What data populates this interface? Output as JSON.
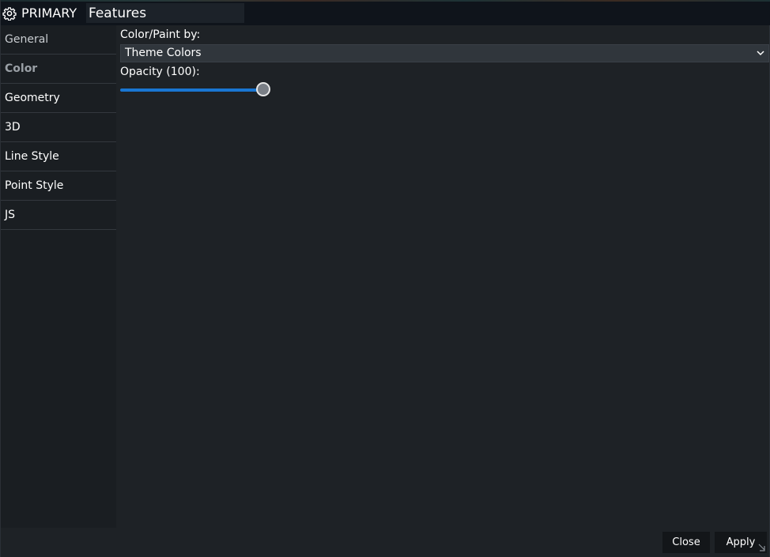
{
  "window": {
    "title_prefix": "PRIMARY",
    "title_value": "Features"
  },
  "sidebar": {
    "items": [
      {
        "label": "General",
        "state": "muted"
      },
      {
        "label": "Color",
        "state": "active"
      },
      {
        "label": "Geometry",
        "state": "normal"
      },
      {
        "label": "3D",
        "state": "normal"
      },
      {
        "label": "Line Style",
        "state": "normal"
      },
      {
        "label": "Point Style",
        "state": "normal"
      },
      {
        "label": "JS",
        "state": "normal"
      }
    ]
  },
  "color_panel": {
    "paint_by_label": "Color/Paint by:",
    "paint_by_value": "Theme Colors",
    "opacity_label": "Opacity (100):",
    "opacity_value": 100
  },
  "footer": {
    "close_label": "Close",
    "apply_label": "Apply"
  },
  "colors": {
    "accent": "#1976d2",
    "background": "#1e2226",
    "titlebar": "#0f141b"
  },
  "icons": {
    "title": "gear-icon",
    "select": "chevron-down-icon",
    "corner": "resize-handle-icon"
  }
}
